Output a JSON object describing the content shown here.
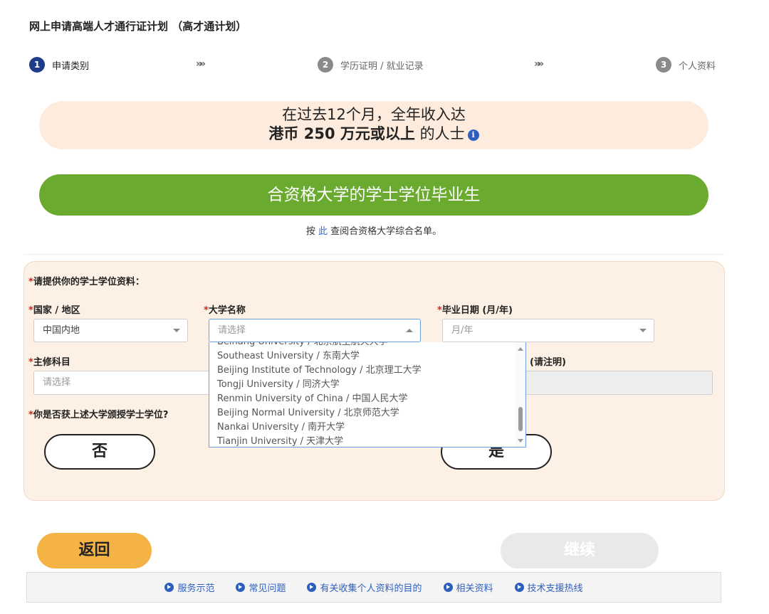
{
  "page": {
    "title": "网上申请高端人才通行证计划 （高才通计划）"
  },
  "steps": [
    {
      "num": "1",
      "label": "申请类别"
    },
    {
      "num": "2",
      "label": "学历证明 / 就业记录"
    },
    {
      "num": "3",
      "label": "个人资料"
    }
  ],
  "step_separator": "»»",
  "banner": {
    "line1": "在过去12个月，全年收入达",
    "line2_bold": "港币 250 万元或以上",
    "line2_rest": " 的人士",
    "info_icon": "i"
  },
  "category_button": "合资格大学的学士学位毕业生",
  "note": {
    "prefix": "按 ",
    "link": "此",
    "suffix": " 查阅合资格大学综合名单。"
  },
  "form": {
    "required_mark": "*",
    "section_title": "请提供你的学士学位资料：",
    "country": {
      "label": "国家 / 地区",
      "value": "中国内地"
    },
    "university": {
      "label": "大学名称",
      "placeholder": "请选择"
    },
    "grad_date": {
      "label": "毕业日期 (月/年)",
      "placeholder": "月/年"
    },
    "major": {
      "label": "主修科目",
      "placeholder": "请选择"
    },
    "other_label_tail": "(请注明)",
    "awarded": {
      "label": "你是否获上述大学颁授学士学位?",
      "no": "否",
      "yes": "是"
    }
  },
  "university_options": [
    "Beihang University / 北京航空航天大学",
    "Southeast University / 东南大学",
    "Beijing Institute of Technology / 北京理工大学",
    "Tongji University / 同济大学",
    "Renmin University of China / 中国人民大学",
    "Beijing Normal University / 北京师范大学",
    "Nankai University / 南开大学",
    "Tianjin University / 天津大学"
  ],
  "buttons": {
    "back": "返回",
    "next": "继续"
  },
  "footer_links": [
    "服务示范",
    "常见问题",
    "有关收集个人资料的目的",
    "相关资料",
    "技术支援热线"
  ],
  "colors": {
    "green": "#6aaa2f",
    "orange": "#f5b245",
    "navy": "#1f3c88",
    "link": "#2e5fbf",
    "required": "#d9261c"
  }
}
